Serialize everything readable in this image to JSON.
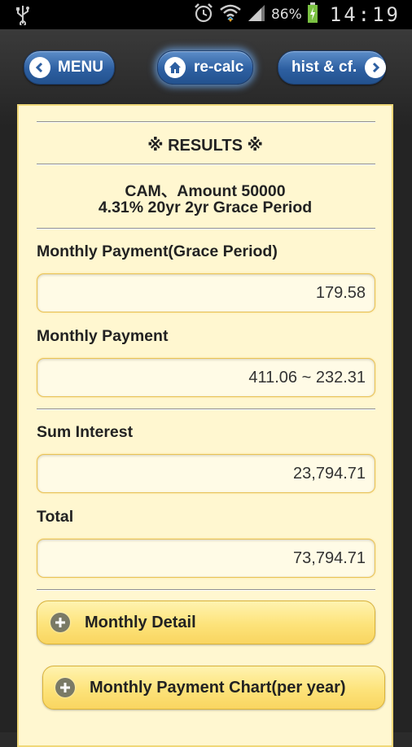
{
  "status_bar": {
    "battery_percent": "86%",
    "clock": "14:19",
    "icons": [
      "usb-icon",
      "alarm-icon",
      "wifi-icon",
      "signal-icon",
      "battery-charging-icon"
    ]
  },
  "nav": {
    "menu_label": "MENU",
    "recalc_label": "re-calc",
    "hist_label": "hist & cf."
  },
  "results": {
    "title": "※ RESULTS ※",
    "summary_line1": "CAM、Amount 50000",
    "summary_line2": "4.31% 20yr 2yr Grace Period",
    "fields": [
      {
        "label": "Monthly Payment(Grace Period)",
        "value": "179.58"
      },
      {
        "label": "Monthly Payment",
        "value": "411.06 ~ 232.31"
      },
      {
        "label": "Sum Interest",
        "value": "23,794.71"
      },
      {
        "label": "Total",
        "value": "73,794.71"
      }
    ],
    "monthly_detail_label": "Monthly Detail",
    "chart_label": "Monthly Payment Chart(per year)"
  },
  "colors": {
    "panel_bg": "#fff7d0",
    "nav_blue": "#2d5fa1",
    "collapsible_yellow": "#fde37a"
  }
}
